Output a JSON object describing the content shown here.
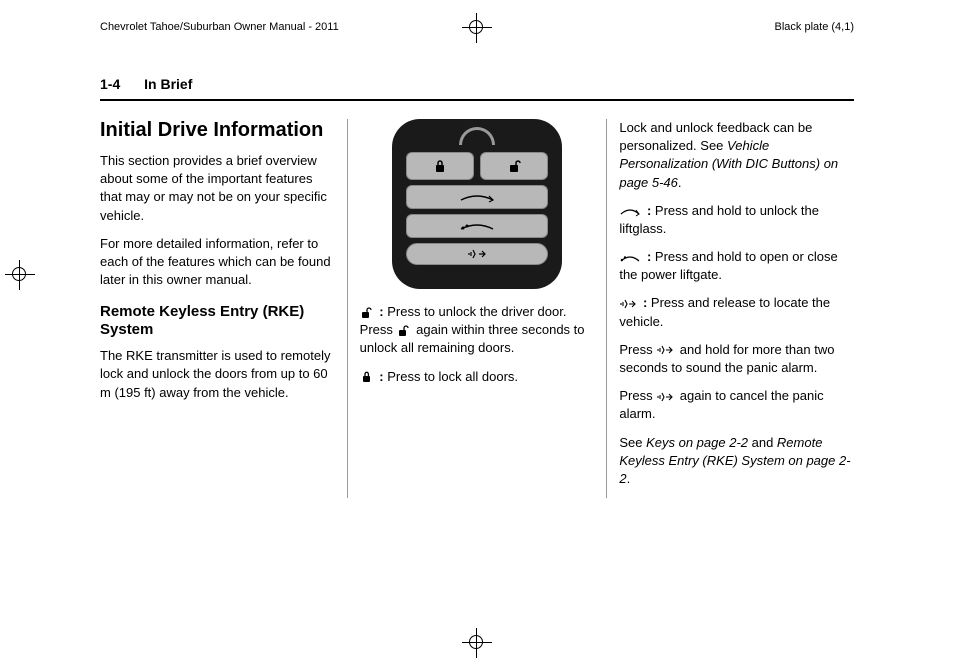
{
  "top": {
    "left": "Chevrolet Tahoe/Suburban Owner Manual - 2011",
    "right": "Black plate (4,1)"
  },
  "header": {
    "page_num": "1-4",
    "section": "In Brief"
  },
  "col1": {
    "h1": "Initial Drive Information",
    "p1": "This section provides a brief overview about some of the important features that may or may not be on your specific vehicle.",
    "p2": "For more detailed information, refer to each of the features which can be found later in this owner manual.",
    "h2": "Remote Keyless Entry (RKE) System",
    "p3": "The RKE transmitter is used to remotely lock and unlock the doors from up to 60 m (195 ft) away from the vehicle."
  },
  "col2": {
    "unlock_colon": " : ",
    "unlock_text": "Press to unlock the driver door. Press ",
    "unlock_text2": " again within three seconds to unlock all remaining doors.",
    "lock_colon": " : ",
    "lock_text": "Press to lock all doors."
  },
  "col3": {
    "p1a": "Lock and unlock feedback can be personalized. See ",
    "p1b": "Vehicle Personalization (With DIC Buttons) on page 5-46",
    "p1c": ".",
    "liftglass_colon": " : ",
    "liftglass": "Press and hold to unlock the liftglass.",
    "liftgate_colon": " : ",
    "liftgate": "Press and hold to open or close the power liftgate.",
    "locate_colon": " : ",
    "locate": "Press and release to locate the vehicle.",
    "panic1a": "Press ",
    "panic1b": " and hold for more than two seconds to sound the panic alarm.",
    "panic2a": "Press ",
    "panic2b": " again to cancel the panic alarm.",
    "see_a": "See ",
    "see_b": "Keys on page 2-2",
    "see_c": " and ",
    "see_d": "Remote Keyless Entry (RKE) System on page 2-2",
    "see_e": "."
  }
}
